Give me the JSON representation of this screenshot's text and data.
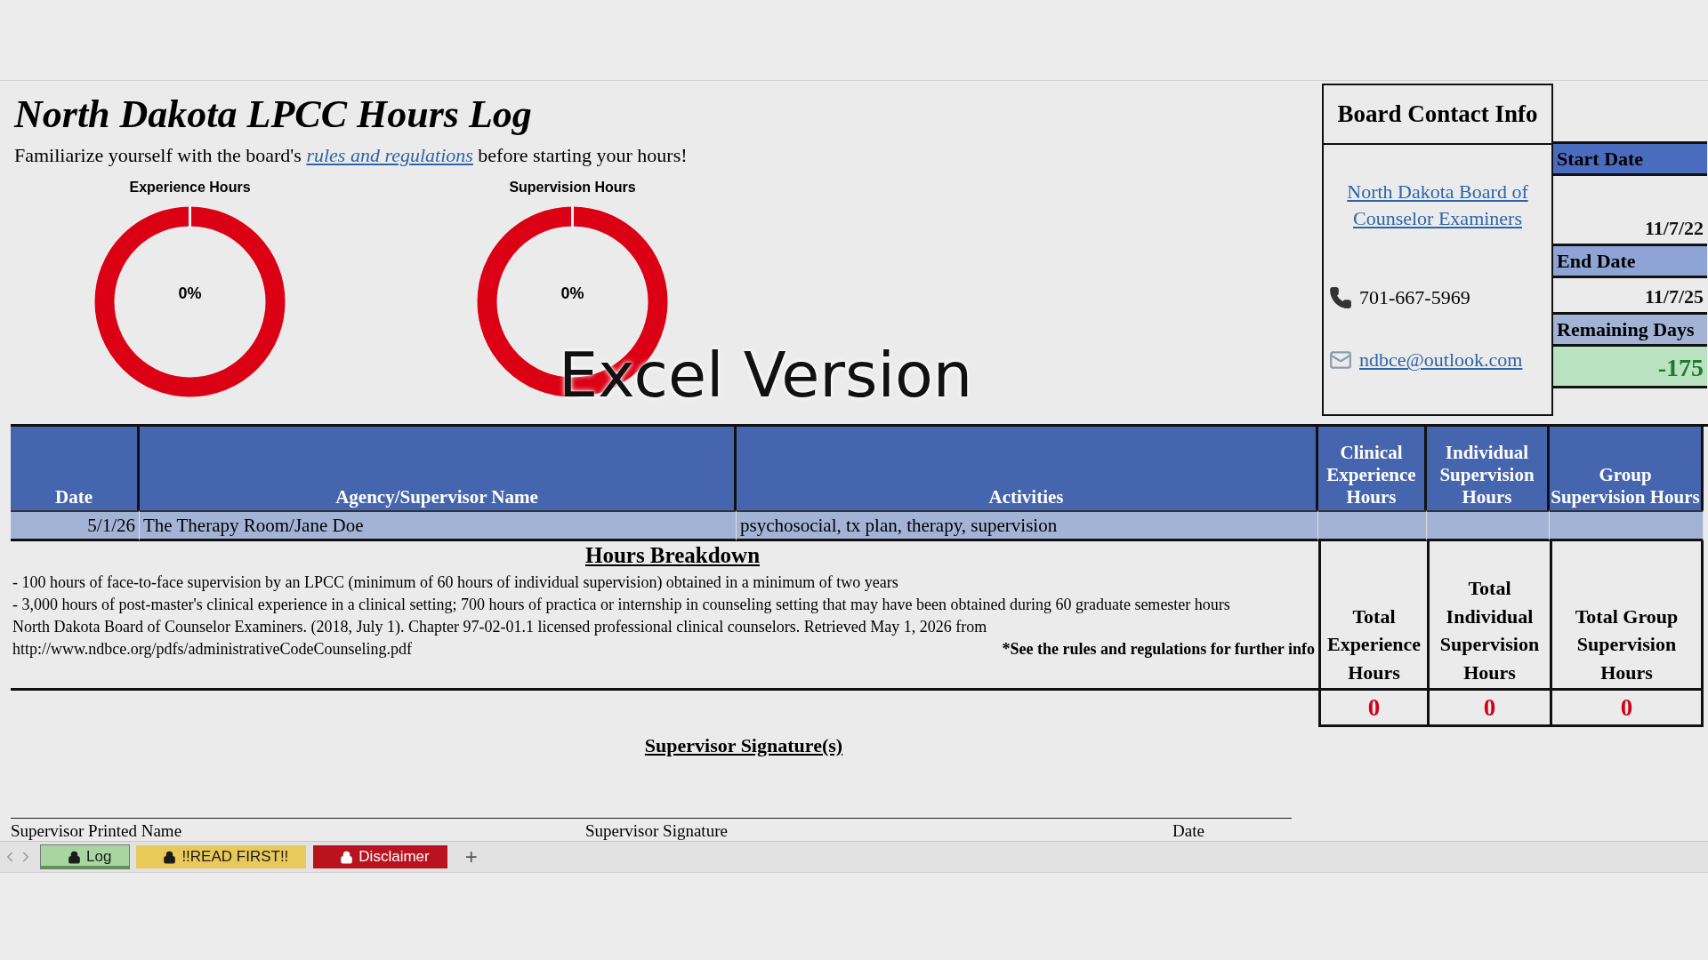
{
  "title": "North Dakota LPCC Hours Log",
  "intro": {
    "before": "Familiarize yourself with the board's",
    "link": "rules and regulations",
    "after": "before starting your hours!"
  },
  "gauges": [
    {
      "title": "Experience Hours",
      "value_label": "0%"
    },
    {
      "title": "Supervision Hours",
      "value_label": "0%"
    }
  ],
  "overlay_caption": "Excel Version",
  "contact": {
    "title": "Board Contact Info",
    "board_link": "North Dakota Board of Counselor Examiners",
    "phone": "701-667-5969",
    "email": "ndbce@outlook.com"
  },
  "dates": [
    {
      "label": "Start Date",
      "value": "11/7/22",
      "kind": "plain"
    },
    {
      "label": "End Date",
      "value": "11/7/25",
      "kind": "plain"
    },
    {
      "label": "Remaining Days",
      "value": "-175",
      "kind": "highlight"
    }
  ],
  "table": {
    "columns": [
      "Date",
      "Agency/Supervisor Name",
      "Activities",
      "Clinical Experience Hours",
      "Individual Supervision Hours",
      "Group Supervision Hours"
    ],
    "rows": [
      [
        "5/1/26",
        "The Therapy Room/Jane Doe",
        "psychosocial, tx plan, therapy, supervision",
        "",
        "",
        ""
      ]
    ]
  },
  "breakdown": {
    "title": "Hours Breakdown",
    "lines": [
      "- 100 hours of face-to-face supervision by an LPCC (minimum of 60 hours of individual supervision) obtained in a minimum of two years",
      "- 3,000 hours of post-master's clinical experience in a clinical setting; 700 hours of practica or internship in counseling setting that may have been obtained during 60 graduate semester hours",
      "North Dakota Board of Counselor Examiners. (2018, July 1). Chapter 97-02-01.1 licensed professional clinical counselors. Retrieved May 1, 2026 from"
    ],
    "url": "http://www.ndbce.org/pdfs/administrativeCodeCounseling.pdf",
    "note": "*See the rules and regulations for further info"
  },
  "totals": [
    {
      "label": "Total Experience Hours",
      "value": "0"
    },
    {
      "label": "Total Individual Supervision Hours",
      "value": "0"
    },
    {
      "label": "Total Group Supervision Hours",
      "value": "0"
    }
  ],
  "signature": {
    "title": "Supervisor Signature(s)",
    "fields": [
      "Supervisor Printed Name",
      "Supervisor Signature",
      "Date"
    ]
  },
  "sheet_tabs": [
    {
      "label": "Log",
      "selected": true,
      "color": "#a9d5a0"
    },
    {
      "label": "!!READ FIRST!!",
      "selected": false,
      "color": "#e8c95a"
    },
    {
      "label": "Disclaimer",
      "selected": false,
      "color": "#b8131f"
    }
  ],
  "add_sheet": "+"
}
